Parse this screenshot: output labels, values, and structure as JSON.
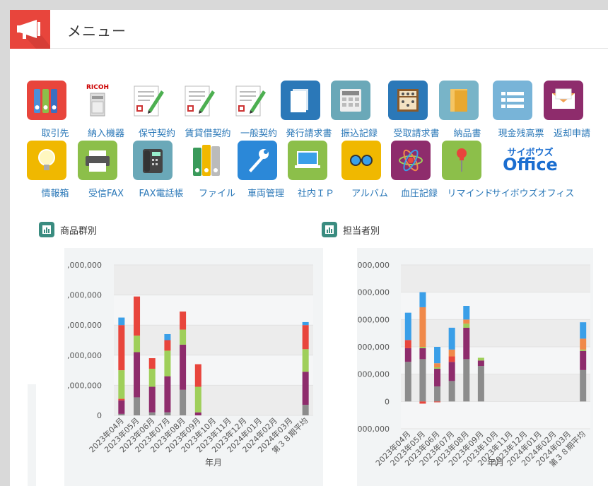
{
  "header": {
    "title": "メニュー"
  },
  "apps": [
    {
      "label": "取引先",
      "icon": "binders-icon",
      "color": "#e8453c"
    },
    {
      "label": "納入機器",
      "icon": "copier-icon",
      "color": "#ffffff"
    },
    {
      "label": "保守契約",
      "icon": "contract-doc-icon",
      "color": "#ffffff"
    },
    {
      "label": "賃貸借契約",
      "icon": "contract-doc-icon",
      "color": "#ffffff"
    },
    {
      "label": "一般契約",
      "icon": "contract-doc-icon",
      "color": "#ffffff"
    },
    {
      "label": "発行請求書",
      "icon": "documents-icon",
      "color": "#2b78b8"
    },
    {
      "label": "振込記録",
      "icon": "calculator-icon",
      "color": "#6aa8b8"
    },
    {
      "label": "受取請求書",
      "icon": "abacus-icon",
      "color": "#2b78b8"
    },
    {
      "label": "納品書",
      "icon": "folder-icon",
      "color": "#78b4c8"
    },
    {
      "label": "現金残高票",
      "icon": "list-icon",
      "color": "#78b4d8"
    },
    {
      "label": "返却申請",
      "icon": "envelope-icon",
      "color": "#8e2c6c"
    },
    {
      "label": "情報箱",
      "icon": "lightbulb-icon",
      "color": "#f0b800"
    },
    {
      "label": "受信FAX",
      "icon": "fax-printer-icon",
      "color": "#8cbf4a"
    },
    {
      "label": "FAX電話帳",
      "icon": "phone-icon",
      "color": "#6aa8b8"
    },
    {
      "label": "ファイル",
      "icon": "file-binders-icon",
      "color": "#ffffff"
    },
    {
      "label": "車両管理",
      "icon": "wrench-icon",
      "color": "#2b88d8"
    },
    {
      "label": "社内ＩＰ",
      "icon": "laptop-icon",
      "color": "#8cbf4a"
    },
    {
      "label": "アルバム",
      "icon": "glasses-icon",
      "color": "#f0b800"
    },
    {
      "label": "血圧記録",
      "icon": "atom-icon",
      "color": "#8e2c6c"
    },
    {
      "label": "リマインド",
      "icon": "pushpin-icon",
      "color": "#8cbf4a"
    },
    {
      "label": "サイボウズオフィス",
      "icon": "cybozu-office-logo",
      "color": "#ffffff",
      "logo_line1": "サイボウズ",
      "logo_line2": "Office"
    }
  ],
  "panels": {
    "left_title": "商品群別",
    "right_title": "担当者別"
  },
  "chart_data": [
    {
      "type": "bar",
      "stacked": true,
      "title": "",
      "xlabel": "年月",
      "ylabel": "",
      "categories": [
        "2023年04月",
        "2023年05月",
        "2023年06月",
        "2023年07月",
        "2023年08月",
        "2023年09月",
        "2023年10月",
        "2023年11月",
        "2023年12月",
        "2024年01月",
        "2024年02月",
        "2024年03月",
        "第３８期平均"
      ],
      "ytick_labels": [
        ",000,000",
        ",000,000",
        ",000,000",
        ",000,000",
        ",000,000",
        "0"
      ],
      "ylim": [
        0,
        5
      ],
      "series": [
        {
          "color": "#8c8c8c",
          "values": [
            0.05,
            0.6,
            0.1,
            0.1,
            0.85,
            0.0,
            0,
            0,
            0,
            0,
            0,
            0,
            0.35
          ]
        },
        {
          "color": "#8e2c6c",
          "values": [
            0.45,
            1.5,
            0.85,
            1.2,
            1.5,
            0.1,
            0,
            0,
            0,
            0,
            0,
            0,
            1.1
          ]
        },
        {
          "color": "#e8453c",
          "values": [
            0.05,
            0.0,
            0.0,
            0.0,
            0.0,
            0.0,
            0,
            0,
            0,
            0,
            0,
            0,
            0.0
          ]
        },
        {
          "color": "#9fcf5a",
          "values": [
            0.95,
            0.55,
            0.6,
            0.85,
            0.5,
            0.85,
            0,
            0,
            0,
            0,
            0,
            0,
            0.75
          ]
        },
        {
          "color": "#e8453c",
          "values": [
            1.5,
            1.3,
            0.35,
            0.35,
            0.6,
            0.75,
            0,
            0,
            0,
            0,
            0,
            0,
            0.8
          ]
        },
        {
          "color": "#3a9fe8",
          "values": [
            0.25,
            0.0,
            0.0,
            0.2,
            0.0,
            0.0,
            0,
            0,
            0,
            0,
            0,
            0,
            0.1
          ]
        }
      ]
    },
    {
      "type": "bar",
      "stacked": true,
      "title": "",
      "xlabel": "年月",
      "ylabel": "",
      "categories": [
        "2023年04月",
        "2023年05月",
        "2023年06月",
        "2023年07月",
        "2023年08月",
        "2023年09月",
        "2023年10月",
        "2023年11月",
        "2023年12月",
        "2024年01月",
        "2024年02月",
        "2024年03月",
        "第３８期平均"
      ],
      "ytick_labels": [
        "000,000",
        "000,000",
        "000,000",
        "000,000",
        "000,000",
        "0",
        "000,000"
      ],
      "ylim": [
        -1,
        5
      ],
      "series": [
        {
          "color": "#8c8c8c",
          "values": [
            1.45,
            1.55,
            0.55,
            0.75,
            1.55,
            1.3,
            0,
            0,
            0,
            0,
            0,
            0,
            1.15
          ]
        },
        {
          "color": "#8e2c6c",
          "values": [
            0.5,
            0.4,
            0.65,
            0.7,
            1.15,
            0.2,
            0,
            0,
            0,
            0,
            0,
            0,
            0.7
          ]
        },
        {
          "color": "#e8453c",
          "values": [
            0.3,
            0.0,
            0.0,
            0.2,
            0.0,
            0.0,
            0,
            0,
            0,
            0,
            0,
            0,
            0.0
          ]
        },
        {
          "color": "#9fcf5a",
          "values": [
            0.0,
            0.05,
            0.05,
            0.0,
            0.15,
            0.1,
            0,
            0,
            0,
            0,
            0,
            0,
            0.05
          ]
        },
        {
          "color": "#f0894a",
          "values": [
            0.0,
            1.45,
            0.15,
            0.25,
            0.15,
            0.0,
            0,
            0,
            0,
            0,
            0,
            0,
            0.4
          ]
        },
        {
          "color": "#3a9fe8",
          "values": [
            1.0,
            0.55,
            0.6,
            0.8,
            0.5,
            0.0,
            0,
            0,
            0,
            0,
            0,
            0,
            0.6
          ]
        }
      ],
      "negative_series": [
        {
          "color": "#e8453c",
          "values": [
            0,
            0.08,
            0.03,
            0,
            0,
            0,
            0,
            0,
            0,
            0,
            0,
            0,
            0
          ]
        }
      ]
    }
  ]
}
